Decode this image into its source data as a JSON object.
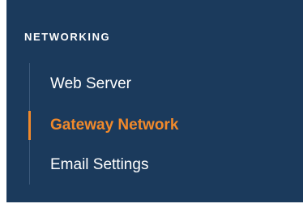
{
  "sidebar": {
    "section_title": "NETWORKING",
    "items": [
      {
        "label": "Web Server",
        "active": false
      },
      {
        "label": "Gateway Network",
        "active": true
      },
      {
        "label": "Email Settings",
        "active": false
      }
    ]
  },
  "colors": {
    "background": "#1b3a5c",
    "accent": "#f0892b",
    "text": "#ffffff"
  }
}
